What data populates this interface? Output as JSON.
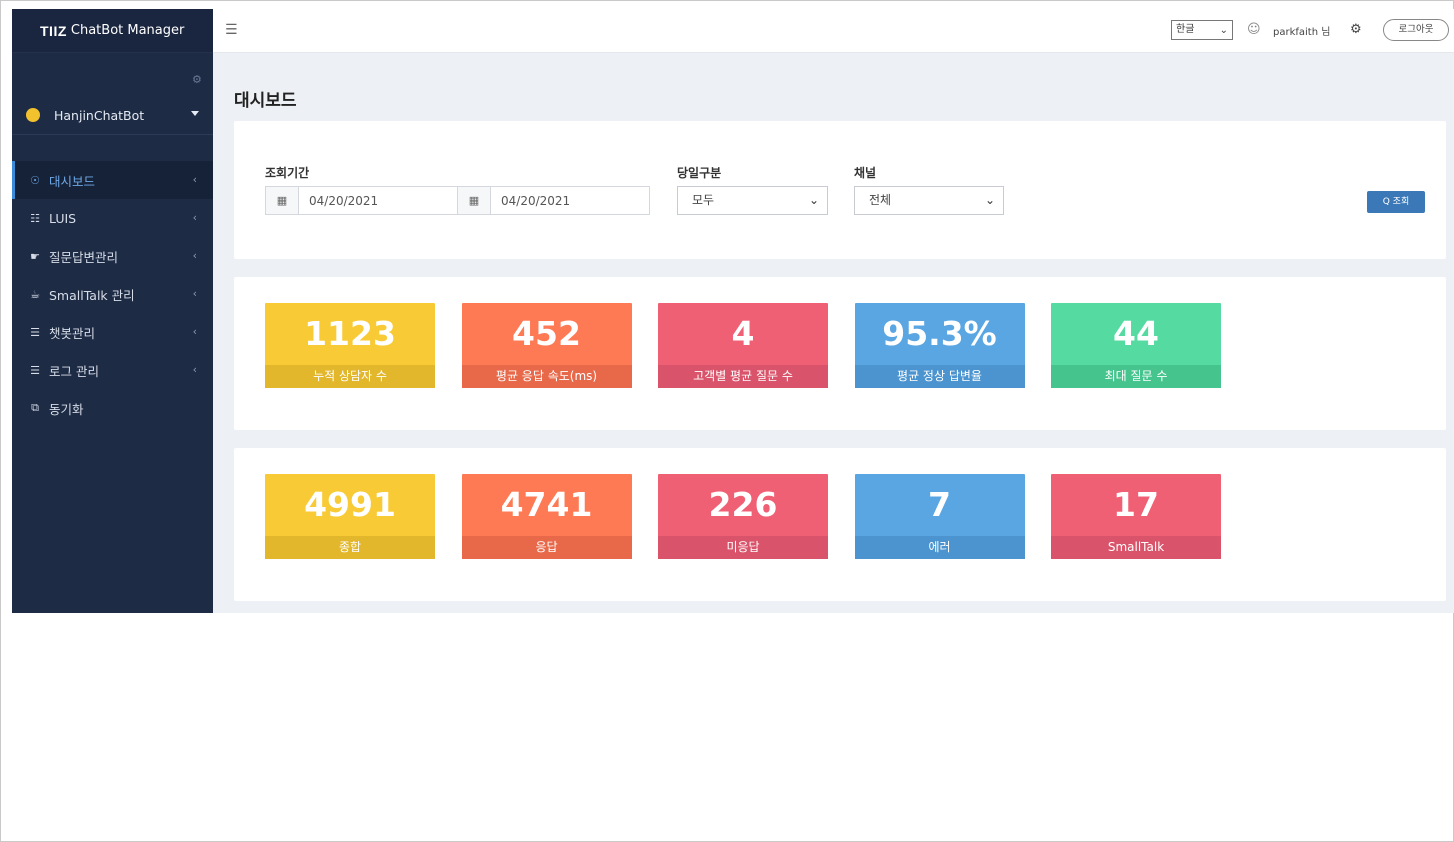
{
  "brand": {
    "strong": "TIIZ",
    "rest": "ChatBot Manager"
  },
  "sidebar": {
    "bot_name": "HanjinChatBot",
    "items": [
      {
        "icon": "dashboard-icon",
        "glyph": "☉",
        "label": "대시보드",
        "active": true
      },
      {
        "icon": "luis-icon",
        "glyph": "☷",
        "label": "LUIS",
        "active": false
      },
      {
        "icon": "megaphone-icon",
        "glyph": "☛",
        "label": "질문답변관리",
        "active": false
      },
      {
        "icon": "smalltalk-icon",
        "glyph": "☕",
        "label": "SmallTalk 관리",
        "active": false
      },
      {
        "icon": "chatbot-icon",
        "glyph": "☰",
        "label": "챗봇관리",
        "active": false
      },
      {
        "icon": "log-icon",
        "glyph": "☰",
        "label": "로그 관리",
        "active": false
      },
      {
        "icon": "sync-icon",
        "glyph": "⧉",
        "label": "동기화",
        "active": false
      }
    ]
  },
  "header": {
    "language": "한글",
    "user": "parkfaith 님",
    "logout": "로그아웃"
  },
  "page": {
    "title": "대시보드"
  },
  "filters": {
    "period_label": "조회기간",
    "date_from": "04/20/2021",
    "date_to": "04/20/2021",
    "day_type_label": "당일구분",
    "day_type_value": "모두",
    "channel_label": "채널",
    "channel_value": "전체",
    "search_button": "Q 조회"
  },
  "stats_row1": [
    {
      "value": "1123",
      "label": "누적 상담자 수",
      "color": "yellow"
    },
    {
      "value": "452",
      "label": "평균 응답 속도(ms)",
      "color": "orange"
    },
    {
      "value": "4",
      "label": "고객별 평균 질문 수",
      "color": "pink"
    },
    {
      "value": "95.3%",
      "label": "평균 정상 답변율",
      "color": "blue"
    },
    {
      "value": "44",
      "label": "최대 질문 수",
      "color": "green"
    }
  ],
  "stats_row2": [
    {
      "value": "4991",
      "label": "종합",
      "color": "yellow"
    },
    {
      "value": "4741",
      "label": "응답",
      "color": "orange"
    },
    {
      "value": "226",
      "label": "미응답",
      "color": "pink"
    },
    {
      "value": "7",
      "label": "에러",
      "color": "blue"
    },
    {
      "value": "17",
      "label": "SmallTalk",
      "color": "pink"
    }
  ],
  "colors": {
    "sidebar": "#1d2b45",
    "accent": "#3a78b8",
    "yellow": "#f8ca35",
    "orange": "#fe7a55",
    "pink": "#f06074",
    "blue": "#5aa6e2",
    "green": "#55dba1"
  }
}
